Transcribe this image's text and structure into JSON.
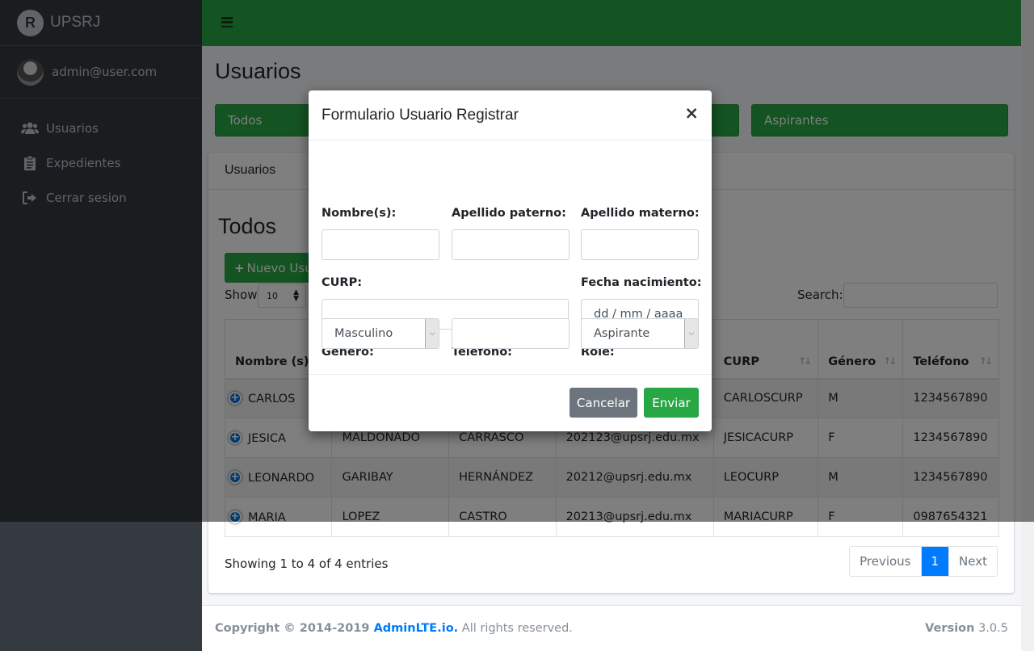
{
  "brand": {
    "logo_letter": "R",
    "name": "UPSRJ"
  },
  "user": {
    "email": "admin@user.com"
  },
  "sidebar": {
    "items": [
      {
        "label": "Usuarios",
        "icon": "users-icon"
      },
      {
        "label": "Expedientes",
        "icon": "clipboard-icon"
      },
      {
        "label": "Cerrar sesion",
        "icon": "sign-out-icon"
      }
    ]
  },
  "page": {
    "title": "Usuarios",
    "filters": {
      "todos": "Todos",
      "aspirantes": "Aspirantes"
    },
    "card_header": "Usuarios",
    "section_title": "Todos",
    "new_button": "Nuevo Usuario",
    "show_label": "Show",
    "show_value": "10",
    "search_label": "Search:"
  },
  "table": {
    "columns": [
      "Nombre (s)",
      "",
      "",
      "",
      "CURP",
      "Género",
      "Teléfono"
    ],
    "rows": [
      [
        "CARLOS",
        "",
        "",
        "",
        "CARLOSCURP",
        "M",
        "1234567890"
      ],
      [
        "JESICA",
        "MALDONADO",
        "CARRASCO",
        "202123@upsrj.edu.mx",
        "JESICACURP",
        "F",
        "1234567890"
      ],
      [
        "LEONARDO",
        "GARIBAY",
        "HERNÁNDEZ",
        "20212@upsrj.edu.mx",
        "LEOCURP",
        "M",
        "1234567890"
      ],
      [
        "MARIA",
        "LOPEZ",
        "CASTRO",
        "20213@upsrj.edu.mx",
        "MARIACURP",
        "F",
        "0987654321"
      ]
    ]
  },
  "pagination": {
    "info": "Showing 1 to 4 of 4 entries",
    "previous": "Previous",
    "current": "1",
    "next": "Next"
  },
  "footer": {
    "copyright": "Copyright © 2014-2019 ",
    "link": "AdminLTE.io.",
    "rights": " All rights reserved.",
    "version_label": "Version",
    "version": "3.0.5"
  },
  "modal": {
    "title": "Formulario Usuario Registrar",
    "close": "×",
    "labels": {
      "nombre": "Nombre(s):",
      "apellido_paterno": "Apellido paterno:",
      "apellido_materno": "Apellido materno:",
      "curp": "CURP:",
      "fecha": "Fecha nacimiento:",
      "genero": "Género:",
      "telefono": "Teléfono:",
      "role": "Role:"
    },
    "values": {
      "fecha_placeholder": "dd / mm / aaaa",
      "genero": "Masculino",
      "role": "Aspirante"
    },
    "buttons": {
      "cancel": "Cancelar",
      "send": "Enviar"
    }
  },
  "colors": {
    "primary_green": "#28a745",
    "sidebar_dark": "#343a40",
    "link_blue": "#007bff"
  }
}
